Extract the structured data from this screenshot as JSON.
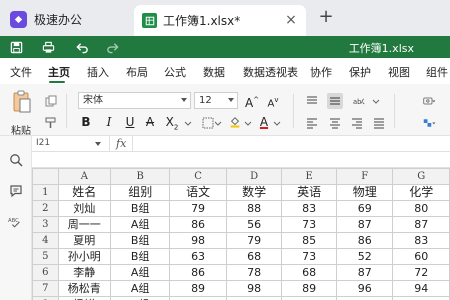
{
  "tabs": {
    "app_title": "极速办公",
    "doc_tab_title": "工作簿1.xlsx*",
    "close_glyph": "×",
    "new_tab_glyph": "+"
  },
  "titlebar": {
    "doc_name": "工作簿1.xlsx",
    "accent": "#21793f"
  },
  "menu": [
    "文件",
    "主页",
    "插入",
    "布局",
    "公式",
    "数据",
    "数据透视表",
    "协作",
    "保护",
    "视图",
    "组件"
  ],
  "menu_active": "主页",
  "ribbon": {
    "paste_label": "粘贴",
    "font_name": "宋体",
    "font_size": "12",
    "grow_font": "A",
    "shrink_font": "A",
    "bold": "B",
    "italic": "I",
    "underline": "U",
    "strikethrough": "A",
    "subscript": "X",
    "font_color_letter": "A"
  },
  "formula_bar": {
    "cell_ref": "I21",
    "fx_label": "fx",
    "formula": ""
  },
  "sheet": {
    "columns": [
      "",
      "A",
      "B",
      "C",
      "D",
      "E",
      "F",
      "G"
    ],
    "rows": [
      {
        "num": "1",
        "cells": [
          "姓名",
          "组别",
          "语文",
          "数学",
          "英语",
          "物理",
          "化学"
        ]
      },
      {
        "num": "2",
        "cells": [
          "刘灿",
          "B组",
          "79",
          "88",
          "83",
          "69",
          "80"
        ]
      },
      {
        "num": "3",
        "cells": [
          "周一一",
          "A组",
          "86",
          "56",
          "73",
          "87",
          "87"
        ]
      },
      {
        "num": "4",
        "cells": [
          "夏明",
          "B组",
          "98",
          "79",
          "85",
          "86",
          "83"
        ]
      },
      {
        "num": "5",
        "cells": [
          "孙小明",
          "B组",
          "63",
          "68",
          "73",
          "52",
          "60"
        ]
      },
      {
        "num": "6",
        "cells": [
          "李静",
          "A组",
          "86",
          "78",
          "68",
          "87",
          "72"
        ]
      },
      {
        "num": "7",
        "cells": [
          "杨松青",
          "A组",
          "89",
          "98",
          "89",
          "96",
          "94"
        ]
      },
      {
        "num": "8",
        "cells": [
          "杨锐",
          "B组",
          "68",
          "74",
          "70",
          "79",
          "63"
        ]
      }
    ]
  },
  "icons": {
    "sidebar": [
      "search-icon",
      "comment-icon",
      "spellcheck-icon"
    ],
    "spell_label": "ABC"
  }
}
